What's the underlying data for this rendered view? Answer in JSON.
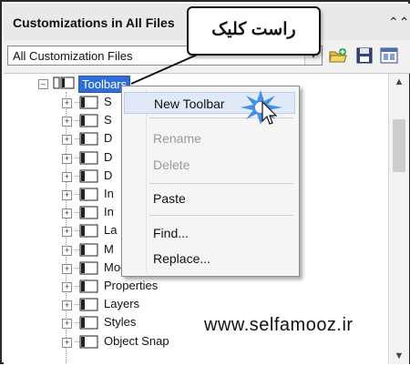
{
  "panel": {
    "title": "Customizations in All Files",
    "collapse_icon": "double-chevron-up-icon"
  },
  "toolbar": {
    "file_filter_value": "All Customization Files",
    "open_icon": "open-folder-icon",
    "save_icon": "save-disk-icon",
    "view_icon": "window-view-icon"
  },
  "tree": {
    "root_label": "Toolbars",
    "items": [
      {
        "label": "S"
      },
      {
        "label": "S"
      },
      {
        "label": "D"
      },
      {
        "label": "D"
      },
      {
        "label": "D"
      },
      {
        "label": "In"
      },
      {
        "label": "In"
      },
      {
        "label": "La"
      },
      {
        "label": "M"
      },
      {
        "label": "Modify II"
      },
      {
        "label": "Properties"
      },
      {
        "label": "Layers"
      },
      {
        "label": "Styles"
      },
      {
        "label": "Object Snap"
      }
    ]
  },
  "context_menu": {
    "items": [
      {
        "label": "New Toolbar",
        "state": "highlighted"
      },
      {
        "label": "Rename",
        "state": "disabled"
      },
      {
        "label": "Delete",
        "state": "disabled"
      },
      {
        "label": "Paste",
        "state": "enabled"
      },
      {
        "label": "Find...",
        "state": "enabled"
      },
      {
        "label": "Replace...",
        "state": "enabled"
      }
    ]
  },
  "callout": {
    "text": "راست کلیک"
  },
  "watermark": "www.selfamooz.ir",
  "colors": {
    "selection": "#2e6fd1",
    "menu_highlight": "#dfe9f7",
    "disabled_text": "#9a9a9a"
  }
}
